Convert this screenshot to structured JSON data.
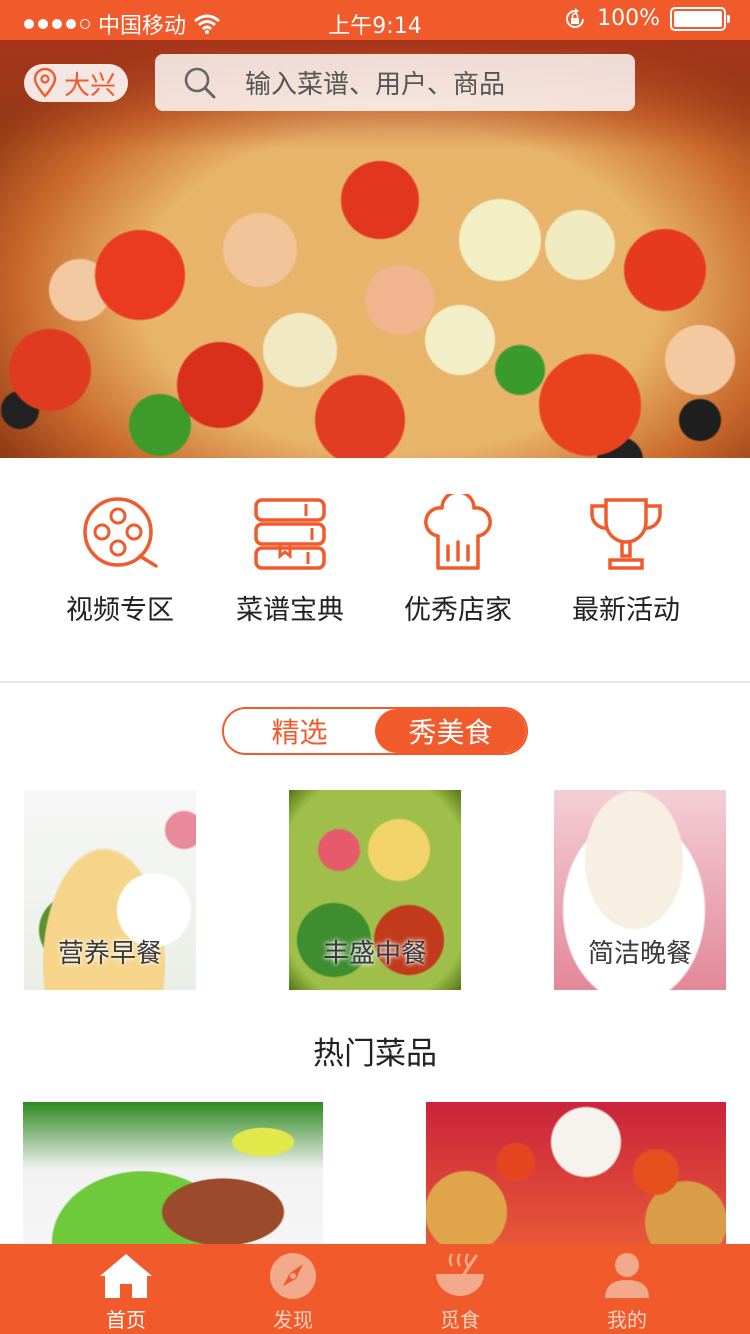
{
  "status_bar": {
    "carrier": "中国移动",
    "time": "上午9:14",
    "battery": "100%"
  },
  "header": {
    "location": "大兴",
    "search_placeholder": "输入菜谱、用户、商品"
  },
  "categories": [
    {
      "label": "视频专区",
      "icon": "film-reel-icon"
    },
    {
      "label": "菜谱宝典",
      "icon": "book-stack-icon"
    },
    {
      "label": "优秀店家",
      "icon": "chef-hat-icon"
    },
    {
      "label": "最新活动",
      "icon": "trophy-icon"
    }
  ],
  "segmented": {
    "options": [
      "精选",
      "秀美食"
    ],
    "selected": "秀美食"
  },
  "meals": [
    {
      "label": "营养早餐"
    },
    {
      "label": "丰盛中餐"
    },
    {
      "label": "简洁晚餐"
    }
  ],
  "hot_section": {
    "title": "热门菜品"
  },
  "tabbar": {
    "items": [
      {
        "label": "首页",
        "icon": "home-icon",
        "active": true
      },
      {
        "label": "发现",
        "icon": "compass-icon",
        "active": false
      },
      {
        "label": "觅食",
        "icon": "food-bowl-icon",
        "active": false
      },
      {
        "label": "我的",
        "icon": "user-icon",
        "active": false
      }
    ]
  },
  "colors": {
    "accent": "#f15a2b"
  }
}
